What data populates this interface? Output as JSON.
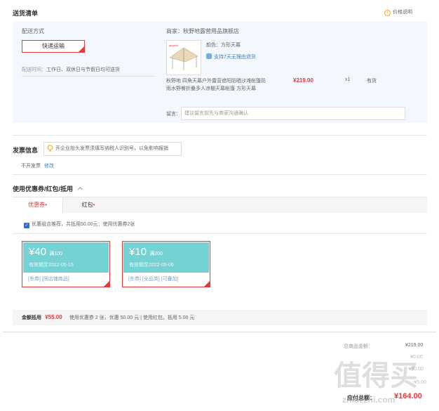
{
  "sections": {
    "shipping_list": "送货清单",
    "price_note": "价格说明",
    "invoice": "发票信息",
    "coupons": "使用优惠券/红包/抵用"
  },
  "shipping": {
    "method_label": "配送方式",
    "method_button": "快递运输",
    "time_label": "配送时间：",
    "time_value": "工作日、双休日与节假日均可送货"
  },
  "store": {
    "merchant_label": "商家：",
    "merchant_name": "秋野地露营用品旗舰店",
    "color_label": "颜色：",
    "color_value": "方形天幕",
    "return_policy": "支持7天无理由退货",
    "product_title": "秋野地 四角天幕户外露营遮阳防晒沙滩帐篷防雨水野餐折叠多人凉棚天幕帐篷 方形天幕",
    "price": "¥219.00",
    "quantity": "x1",
    "stock": "有货",
    "remark_label": "留言：",
    "remark_placeholder": "建议留言前先与商家沟通确认"
  },
  "invoice": {
    "tip": "开企业抬头发票须填写纳税人识别号，以免影响报销",
    "status": "不开发票",
    "edit_link": "修改"
  },
  "coupon_section": {
    "tab_coupons": "优惠券",
    "tab_redpacket": "红包",
    "combo_text": "优惠组合推荐，共抵用50.00元：使用优惠券2张",
    "coupons": [
      {
        "amount": "¥40",
        "condition": "满100",
        "expiry": "有效期至2022-05-15",
        "tags": "[东券]  [限店铺商品]"
      },
      {
        "amount": "¥10",
        "condition": "满200",
        "expiry": "有效期至2022-05-06",
        "tags": "[东券]  [全品类]  [可叠加]"
      }
    ],
    "discount_label": "金额抵用",
    "discount_amount": "¥55.00",
    "discount_detail": "使用优惠券 2 张，优惠 50.00 元  | 使用红包，抵用 5.00 元"
  },
  "summary": {
    "total_label": "总商品金额：",
    "total_value": "¥219.00",
    "row2_value": "¥0.00",
    "row3_value": "-¥50.00",
    "row4_value": "-¥5.00",
    "payable_label": "应付总额：",
    "payable_value": "¥164.00"
  },
  "watermark": {
    "main": "值得买",
    "url": "zhidezhi.com"
  },
  "colors": {
    "accent": "#e4393c",
    "coupon": "#74d2d4",
    "link": "#3b7fc4",
    "card_bg": "#f3f8fe"
  }
}
